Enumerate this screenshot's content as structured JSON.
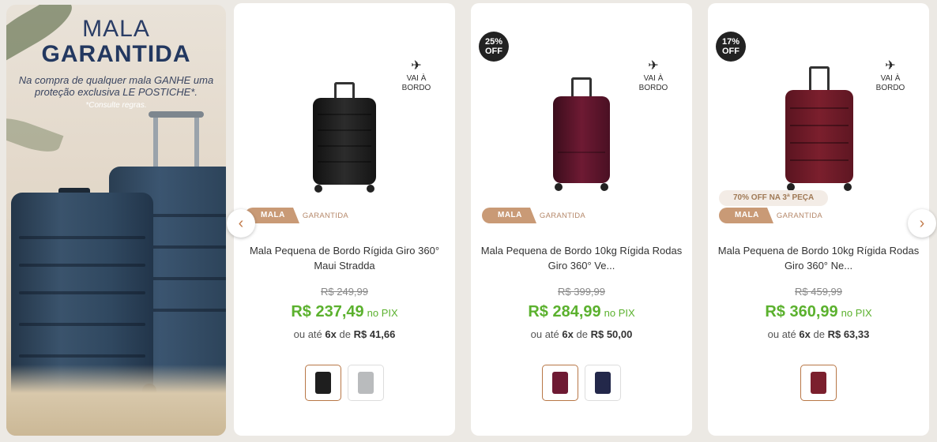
{
  "banner": {
    "title_line1": "MALA",
    "title_line2": "GARANTIDA",
    "description": "Na compra de qualquer mala GANHE uma proteção exclusiva LE POSTICHE*.",
    "note": "*Consulte regras."
  },
  "carousel": {
    "prev_icon": "‹",
    "next_icon": "›"
  },
  "products": [
    {
      "discount": "",
      "onboard": "VAI À BORDO",
      "promo": "",
      "tag_main": "MALA",
      "tag_sub": "GARANTIDA",
      "name": "Mala Pequena de Bordo Rígida Giro 360° Maui Stradda",
      "old_price": "R$ 249,99",
      "price": "R$ 237,49",
      "pix_label": "no PIX",
      "installment_prefix": "ou até",
      "installment_count": "6x",
      "installment_mid": "de",
      "installment_value": "R$ 41,66",
      "colors": [
        "#1e1e1e",
        "#b9bbbd"
      ]
    },
    {
      "discount": "25% OFF",
      "onboard": "VAI À BORDO",
      "promo": "",
      "tag_main": "MALA",
      "tag_sub": "GARANTIDA",
      "name": "Mala Pequena de Bordo 10kg Rígida Rodas Giro 360° Ve...",
      "old_price": "R$ 399,99",
      "price": "R$ 284,99",
      "pix_label": "no PIX",
      "installment_prefix": "ou até",
      "installment_count": "6x",
      "installment_mid": "de",
      "installment_value": "R$ 50,00",
      "colors": [
        "#6e1a33",
        "#23284a"
      ]
    },
    {
      "discount": "17% OFF",
      "onboard": "VAI À BORDO",
      "promo": "70% OFF NA 3ª PEÇA",
      "tag_main": "MALA",
      "tag_sub": "GARANTIDA",
      "name": "Mala Pequena de Bordo 10kg Rígida Rodas Giro 360° Ne...",
      "old_price": "R$ 459,99",
      "price": "R$ 360,99",
      "pix_label": "no PIX",
      "installment_prefix": "ou até",
      "installment_count": "6x",
      "installment_mid": "de",
      "installment_value": "R$ 63,33",
      "colors": [
        "#7b1f2d"
      ]
    }
  ]
}
